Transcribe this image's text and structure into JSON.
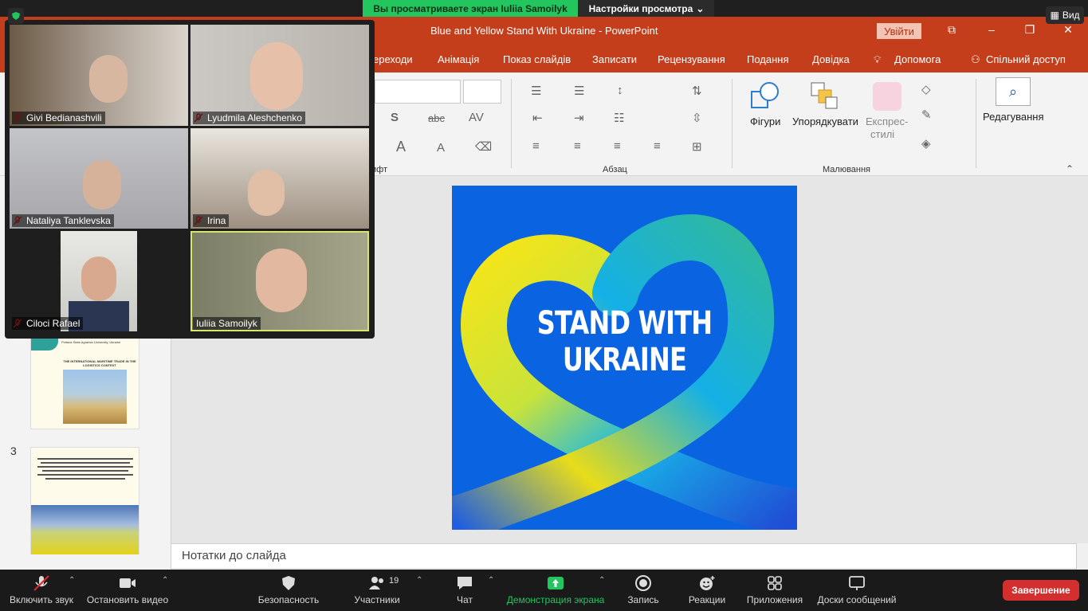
{
  "zoom_top": {
    "share_banner": "Вы просматриваете экран Iuliia Samoilyk",
    "view_options": "Настройки просмотра",
    "view_button": "Вид"
  },
  "ppt": {
    "window_title": "Blue and Yellow Stand With Ukraine  -  PowerPoint",
    "signin": "Увійти",
    "tabs": [
      "ереходи",
      "Анімація",
      "Показ слайдів",
      "Записати",
      "Рецензування",
      "Подання",
      "Довідка",
      "Допомога",
      "Спільний доступ"
    ],
    "ribbon": {
      "font_group_suffix": "ифт",
      "paragraph_group": "Абзац",
      "drawing_group": "Малювання",
      "shapes": "Фігури",
      "arrange": "Упорядкувати",
      "quick_styles_line1": "Експрес-",
      "quick_styles_line2": "стилі",
      "editing": "Редагування"
    },
    "slide_text_line1": "STAND WITH",
    "slide_text_line2": "UKRAINE",
    "thumb3_number": "3",
    "thumb2_caption_line1": "Poltava State Agrarian University, Ukraine",
    "thumb2_caption_line2": "THE INTERNATIONAL MARITIME TRADE IN THE LOGISTICS CONTEXT",
    "notes_placeholder": "Нотатки до слайда"
  },
  "participants": [
    {
      "name": "Givi Bedianashvili",
      "muted": true
    },
    {
      "name": "Lyudmila Aleshchenko",
      "muted": true
    },
    {
      "name": "Nataliya Tanklevska",
      "muted": true
    },
    {
      "name": "Irina",
      "muted": true
    },
    {
      "name": "Ciloci Rafael",
      "muted": true
    },
    {
      "name": "Iuliia Samoilyk",
      "muted": false,
      "active_speaker": true
    }
  ],
  "zoom_bar": {
    "unmute": "Включить звук",
    "stop_video": "Остановить видео",
    "security": "Безопасность",
    "participants": "Участники",
    "participants_count": "19",
    "chat": "Чат",
    "share_screen": "Демонстрация экрана",
    "record": "Запись",
    "reactions": "Реакции",
    "apps": "Приложения",
    "whiteboards": "Доски сообщений",
    "end": "Завершение"
  },
  "colors": {
    "ppt_accent": "#c43e1c",
    "share_green": "#22c55e",
    "slide_blue": "#0a63e0",
    "end_red": "#d32f2f"
  }
}
